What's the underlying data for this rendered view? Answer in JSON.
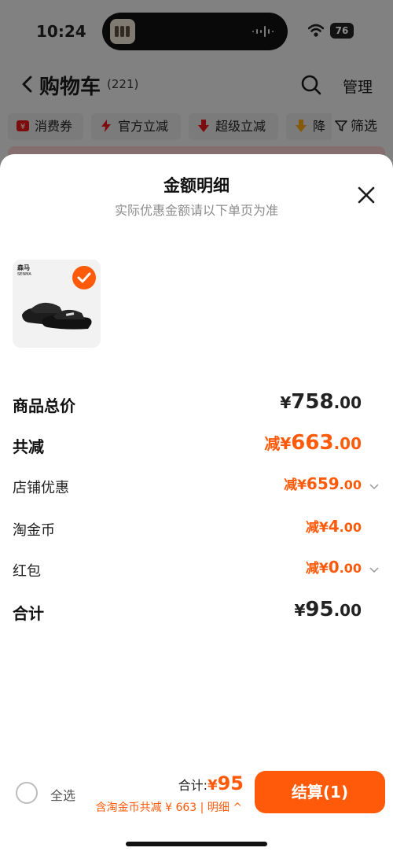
{
  "status_bar": {
    "time": "10:24",
    "battery": "76"
  },
  "nav": {
    "title": "购物车",
    "count": "(221)",
    "manage_label": "管理"
  },
  "chips": [
    {
      "label": "消费券",
      "icon": "coupon-icon"
    },
    {
      "label": "官方立减",
      "icon": "lightning-icon"
    },
    {
      "label": "超级立减",
      "icon": "down-arrow-icon"
    },
    {
      "label": "降",
      "icon": "price-drop-icon"
    }
  ],
  "filter_label": "筛选",
  "sheet": {
    "title": "金额明细",
    "subtitle": "实际优惠金额请以下单页为准",
    "product": {
      "brand_line1": "森马",
      "brand_line2": "SENMA",
      "selected": true
    }
  },
  "rows": {
    "total_price": {
      "label": "商品总价",
      "currency": "¥",
      "int": "758",
      "dec": ".00"
    },
    "total_discount": {
      "label": "共减",
      "prefix": "减",
      "currency": "¥",
      "int": "663",
      "dec": ".00"
    },
    "shop_discount": {
      "label": "店铺优惠",
      "prefix": "减",
      "currency": "¥",
      "int": "659",
      "dec": ".00"
    },
    "coins": {
      "label": "淘金币",
      "prefix": "减",
      "currency": "¥",
      "int": "4",
      "dec": ".00"
    },
    "red_packet": {
      "label": "红包",
      "prefix": "减",
      "currency": "¥",
      "int": "0",
      "dec": ".00"
    },
    "sum": {
      "label": "合计",
      "currency": "¥",
      "int": "95",
      "dec": ".00"
    }
  },
  "bottom": {
    "select_all": "全选",
    "total_label": "合计:",
    "total_currency": "¥",
    "total_value": "95",
    "detail": "含淘金币共减 ¥ 663 | 明细 ^",
    "checkout_label": "结算(1)"
  },
  "colors": {
    "accent": "#ff5a0a"
  }
}
